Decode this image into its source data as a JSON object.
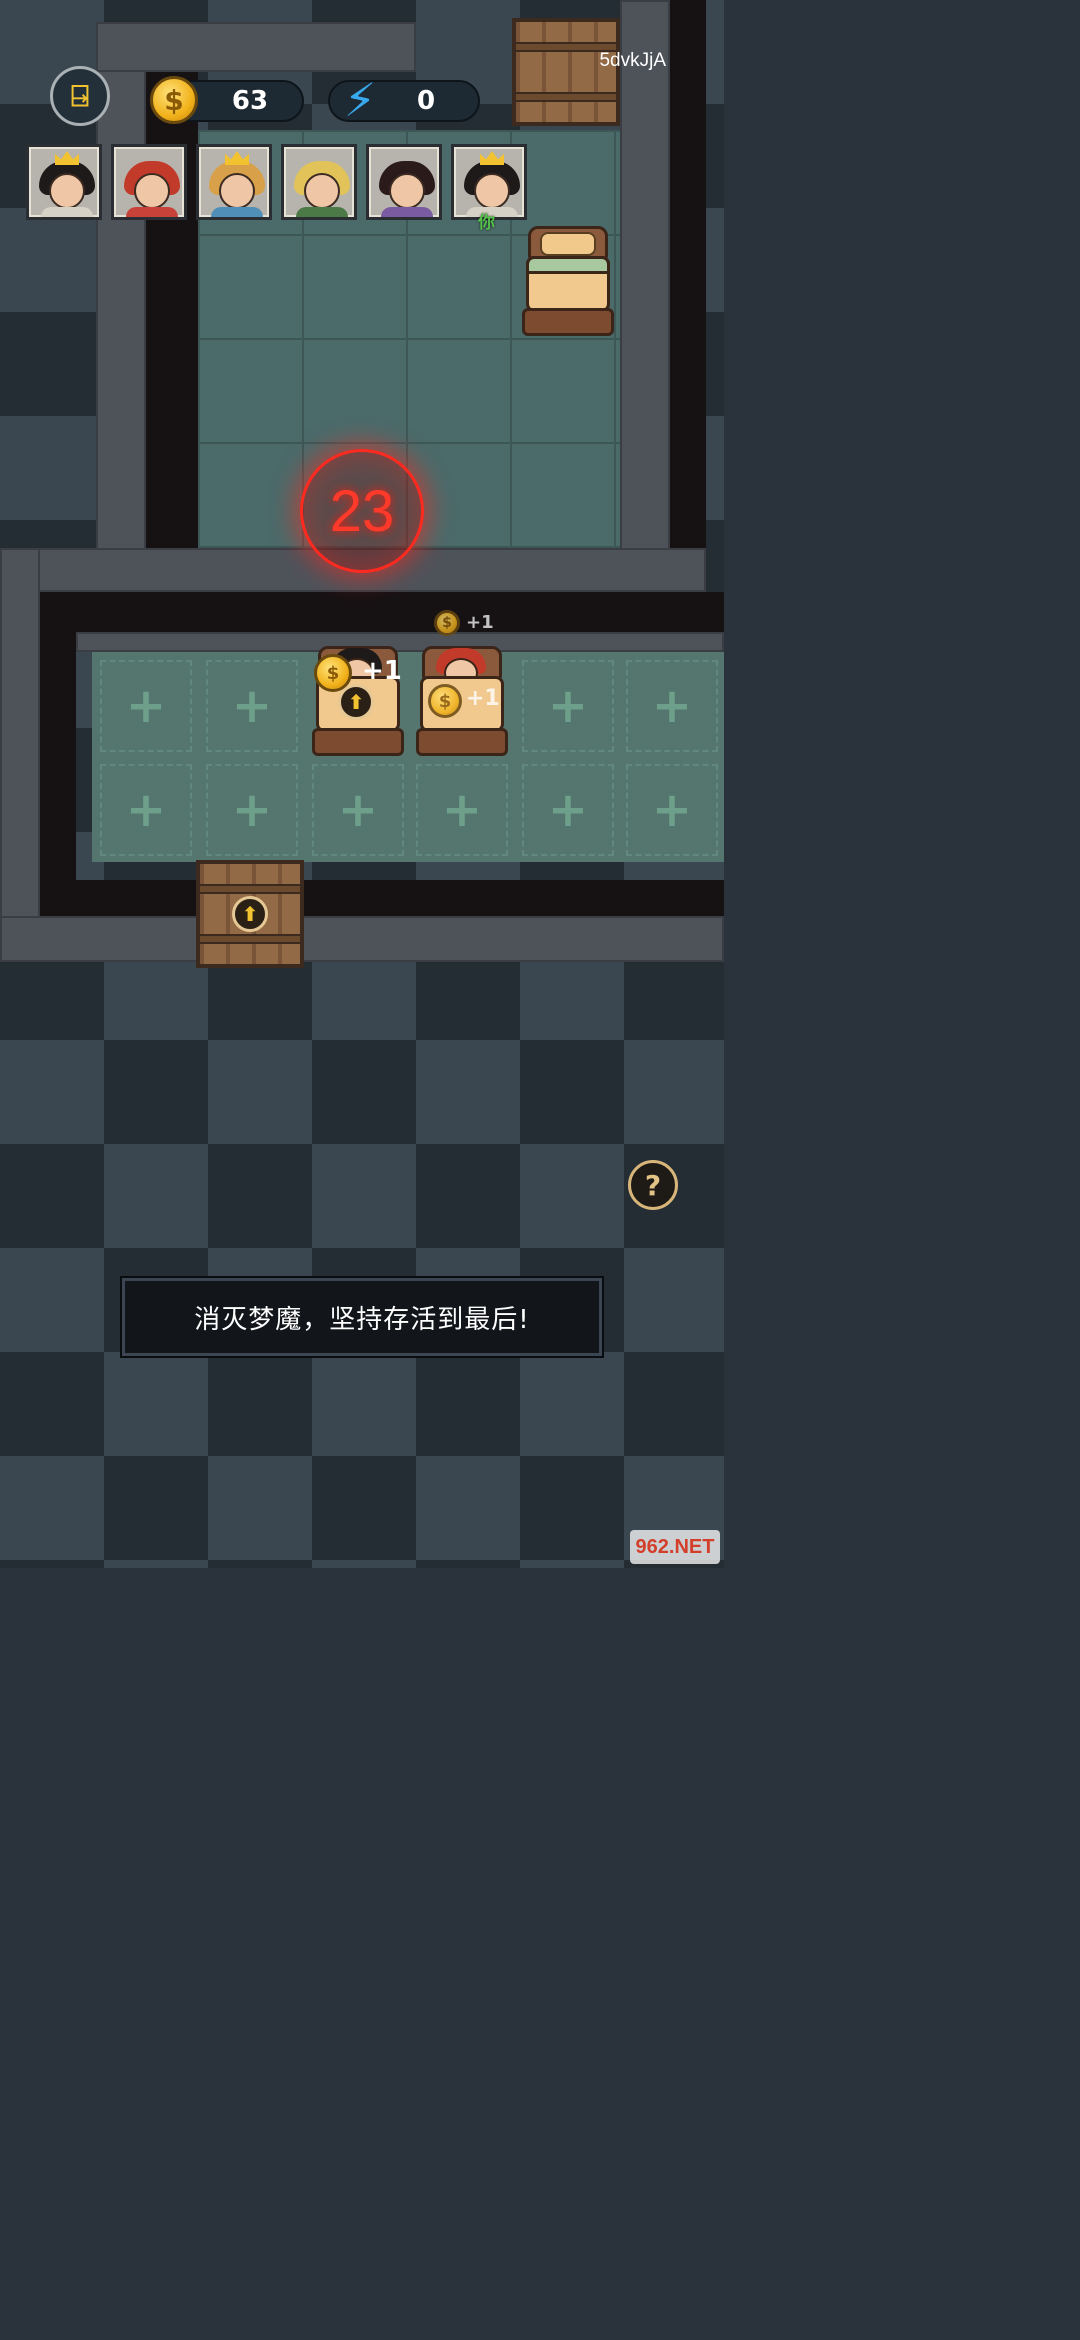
{
  "hud": {
    "coins": "63",
    "energy": "0",
    "room_code": "5dvkJjA",
    "coin_symbol": "$",
    "exit_icon": "exit-door-icon",
    "energy_icon": "lightning-bolt-icon"
  },
  "players": [
    {
      "name": "player-1",
      "hair": "#1f1a1a",
      "crown": true
    },
    {
      "name": "player-2",
      "hair": "#c23a2a",
      "crown": false
    },
    {
      "name": "player-3",
      "hair": "#d9a04a",
      "crown": true
    },
    {
      "name": "player-4",
      "hair": "#e2c35a",
      "crown": false
    },
    {
      "name": "player-5",
      "hair": "#2a1a1a",
      "crown": false
    },
    {
      "name": "player-6",
      "hair": "#1f1a1a",
      "crown": true
    }
  ],
  "you_label": "你",
  "timer": "23",
  "income": {
    "bed_1": "+1",
    "bed_2_top": "+1",
    "bed_2": "+1"
  },
  "tip": "消灭梦魔，坚持存活到最后!",
  "help_label": "?",
  "upgrade_symbol": "⬆",
  "watermark": "962.NET",
  "colors": {
    "timer_red": "#ff2a1f",
    "coin_gold": "#f1b21b",
    "energy_blue": "#39a9ef",
    "you_green": "#56c14c"
  }
}
